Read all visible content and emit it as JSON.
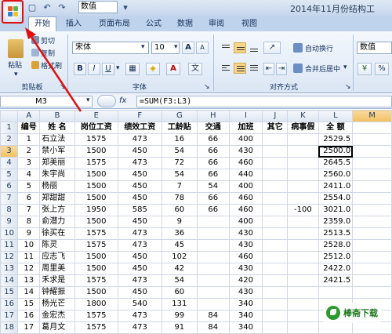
{
  "title_bar": {
    "title": "2014年11月份结构工",
    "qat_font_value": "数值",
    "qat_buttons": [
      "save-icon",
      "undo-icon",
      "redo-icon",
      "dropdown-icon"
    ]
  },
  "ribbon_tabs": [
    {
      "label": "开始",
      "active": true
    },
    {
      "label": "插入"
    },
    {
      "label": "页面布局"
    },
    {
      "label": "公式"
    },
    {
      "label": "数据"
    },
    {
      "label": "审阅"
    },
    {
      "label": "视图"
    }
  ],
  "clipboard": {
    "paste_label": "粘贴",
    "cut_label": "剪切",
    "copy_label": "复制",
    "format_painter_label": "格式刷",
    "group_label": "剪贴板"
  },
  "font": {
    "name_value": "宋体",
    "size_value": "10",
    "bold": "B",
    "italic": "I",
    "underline": "U",
    "color_button": "A",
    "phonetic_button": "文",
    "grow_button": "A",
    "shrink_button": "A",
    "group_label": "字体"
  },
  "alignment": {
    "wrap_text_label": "自动换行",
    "merge_center_label": "合并后居中",
    "group_label": "对齐方式"
  },
  "number": {
    "format_value": "数值",
    "percent_label": "%"
  },
  "formula_bar": {
    "name_box": "M3",
    "fx_label": "fx",
    "formula": "=SUM(F3:L3)"
  },
  "sheet": {
    "columns": [
      "A",
      "B",
      "E",
      "F",
      "G",
      "H",
      "I",
      "J",
      "K",
      "L",
      "M"
    ],
    "selected_column": "M",
    "selected_row": "3",
    "header_row": [
      "编号",
      "姓 名",
      "岗位工资",
      "绩效工资",
      "工龄贴",
      "交通",
      "加班",
      "其它",
      "病事假",
      "全 额"
    ],
    "rows": [
      {
        "row": "2",
        "cells": [
          "1",
          "石立法",
          "1575",
          "473",
          "16",
          "66",
          "400",
          "",
          "",
          "2529.5"
        ]
      },
      {
        "row": "3",
        "cells": [
          "2",
          "禁小军",
          "1500",
          "450",
          "54",
          "66",
          "430",
          "",
          "",
          "2500.0"
        ]
      },
      {
        "row": "4",
        "cells": [
          "3",
          "郑美丽",
          "1575",
          "473",
          "72",
          "66",
          "460",
          "",
          "",
          "2645.5"
        ]
      },
      {
        "row": "5",
        "cells": [
          "4",
          "朱宇尚",
          "1500",
          "450",
          "54",
          "66",
          "440",
          "",
          "",
          "2560.0"
        ]
      },
      {
        "row": "6",
        "cells": [
          "5",
          "杨丽",
          "1500",
          "450",
          "7",
          "54",
          "400",
          "",
          "",
          "2411.0"
        ]
      },
      {
        "row": "7",
        "cells": [
          "6",
          "郑甜甜",
          "1500",
          "450",
          "78",
          "66",
          "460",
          "",
          "",
          "2554.0"
        ]
      },
      {
        "row": "8",
        "cells": [
          "7",
          "张上方",
          "1950",
          "585",
          "60",
          "66",
          "460",
          "",
          "-100",
          "3021.0"
        ]
      },
      {
        "row": "9",
        "cells": [
          "8",
          "俞潜力",
          "1500",
          "450",
          "9",
          "",
          "400",
          "",
          "",
          "2359.0"
        ]
      },
      {
        "row": "10",
        "cells": [
          "9",
          "徐买在",
          "1575",
          "473",
          "36",
          "",
          "430",
          "",
          "",
          "2513.5"
        ]
      },
      {
        "row": "11",
        "cells": [
          "10",
          "陈灵",
          "1575",
          "473",
          "45",
          "",
          "430",
          "",
          "",
          "2528.0"
        ]
      },
      {
        "row": "12",
        "cells": [
          "11",
          "应志飞",
          "1500",
          "450",
          "102",
          "",
          "460",
          "",
          "",
          "2512.0"
        ]
      },
      {
        "row": "13",
        "cells": [
          "12",
          "周里美",
          "1500",
          "450",
          "42",
          "",
          "430",
          "",
          "",
          "2422.0"
        ]
      },
      {
        "row": "14",
        "cells": [
          "13",
          "禾求是",
          "1575",
          "473",
          "54",
          "",
          "420",
          "",
          "",
          "2421.5"
        ]
      },
      {
        "row": "15",
        "cells": [
          "14",
          "钟耀振",
          "1500",
          "450",
          "60",
          "",
          "430",
          "",
          "",
          ""
        ]
      },
      {
        "row": "16",
        "cells": [
          "15",
          "杨光芒",
          "1800",
          "540",
          "131",
          "",
          "340",
          "",
          "",
          ""
        ]
      },
      {
        "row": "17",
        "cells": [
          "16",
          "金宏杰",
          "1575",
          "473",
          "99",
          "84",
          "340",
          "",
          "",
          ""
        ]
      },
      {
        "row": "18",
        "cells": [
          "17",
          "葛月文",
          "1575",
          "473",
          "91",
          "84",
          "340",
          "",
          "",
          ""
        ]
      }
    ]
  },
  "watermark": {
    "text": "棒斋下载",
    "icon": "leaf-logo-icon"
  },
  "colors": {
    "annotation_arrow": "#e01010",
    "selected_header": "#f1c15f"
  }
}
